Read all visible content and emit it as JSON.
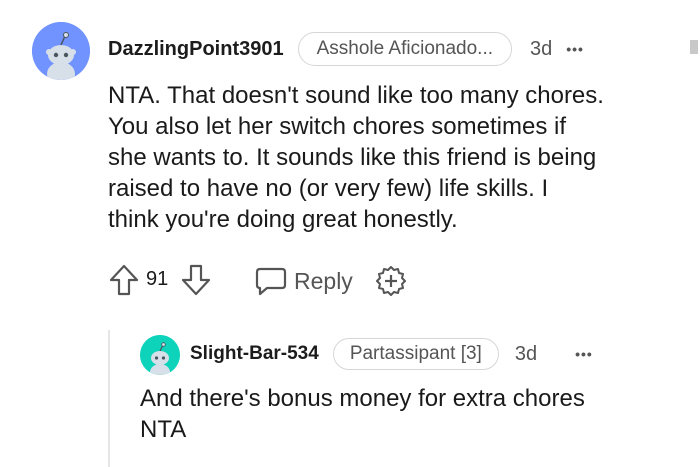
{
  "comment": {
    "username": "DazzlingPoint3901",
    "flair": "Asshole Aficionado...",
    "age": "3d",
    "more": "•••",
    "body_lines": [
      "NTA. That doesn't sound like too many chores.",
      "You also let her switch chores sometimes if",
      "she wants to. It sounds like this friend is being",
      "raised to have no (or very few) life skills. I",
      "think you're doing great honestly."
    ],
    "votes": "91",
    "reply_label": "Reply",
    "avatar_color": "#7193ff"
  },
  "reply": {
    "username": "Slight-Bar-534",
    "flair": "Partassipant [3]",
    "age": "3d",
    "more": "•••",
    "body_lines": [
      "And there's bonus money for extra chores",
      "NTA"
    ],
    "avatar_color": "#0dd3bb"
  },
  "colors": {
    "text": "#1a1a1b",
    "meta": "#555555",
    "thread_line": "#e6e6e6"
  },
  "icons": {
    "upvote": "arrow-up-icon",
    "downvote": "arrow-down-icon",
    "reply": "speech-bubble-icon",
    "award": "plus-badge-icon"
  }
}
